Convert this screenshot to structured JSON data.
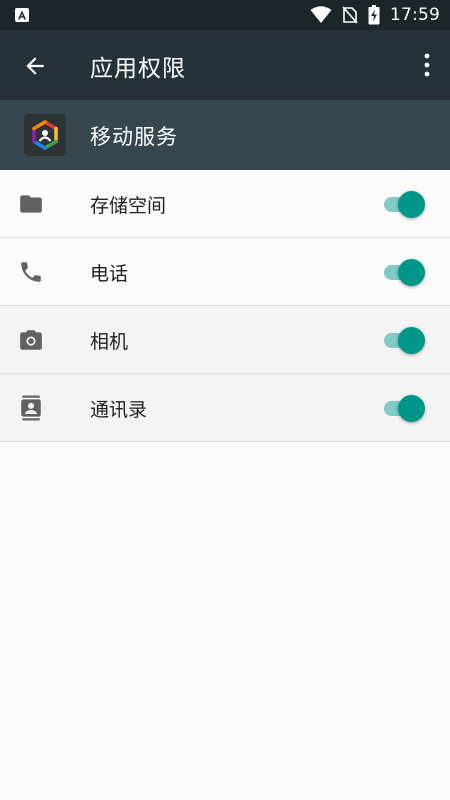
{
  "status_bar": {
    "time": "17:59",
    "icons": [
      "notification-icon",
      "wifi-icon",
      "no-sim-icon",
      "battery-charging-icon"
    ]
  },
  "app_bar": {
    "title": "应用权限",
    "back_icon": "arrow-back-icon",
    "menu_icon": "more-vert-icon"
  },
  "app_header": {
    "name": "移动服务",
    "icon": "app-logo-icon"
  },
  "permissions": [
    {
      "label": "存储空间",
      "icon": "folder-icon",
      "enabled": true
    },
    {
      "label": "电话",
      "icon": "phone-icon",
      "enabled": true
    },
    {
      "label": "相机",
      "icon": "camera-icon",
      "enabled": true
    },
    {
      "label": "通讯录",
      "icon": "contacts-icon",
      "enabled": true
    }
  ],
  "colors": {
    "status_bar": "#1d2529",
    "app_bar": "#263238",
    "app_header": "#37474f",
    "accent": "#009688",
    "toggle_track": "#80cbc4"
  }
}
